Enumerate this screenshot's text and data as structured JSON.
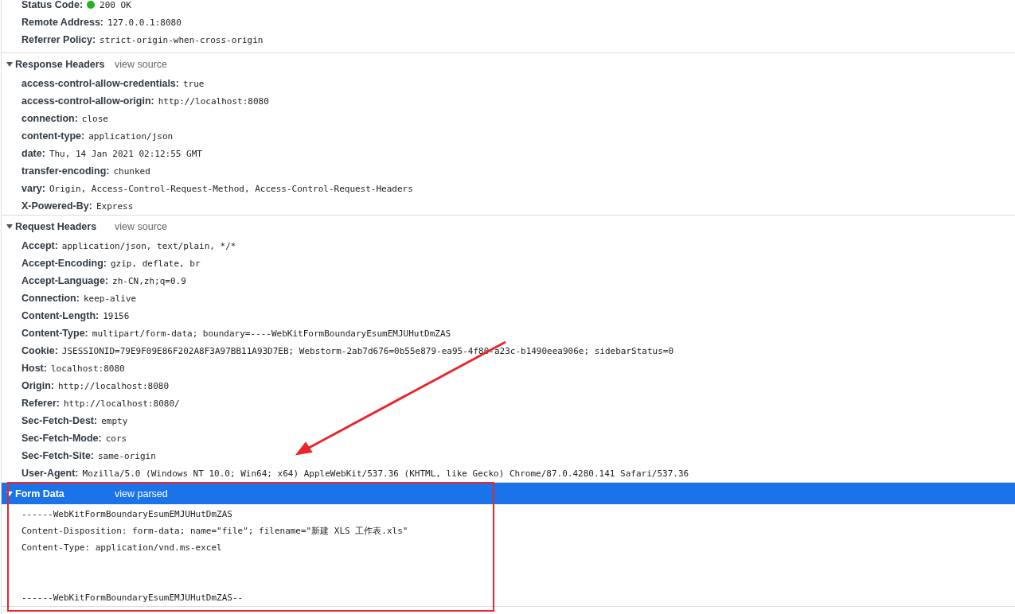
{
  "general": {
    "rows": [
      {
        "name": "Status Code:",
        "value": "200 OK",
        "kind": "status"
      },
      {
        "name": "Remote Address:",
        "value": "127.0.0.1:8080",
        "kind": "plain"
      },
      {
        "name": "Referrer Policy:",
        "value": "strict-origin-when-cross-origin",
        "kind": "plain"
      }
    ]
  },
  "sections": [
    {
      "title": "Response Headers",
      "link": "view source",
      "expanded": true,
      "selected": false,
      "rows": [
        {
          "name": "access-control-allow-credentials:",
          "value": "true"
        },
        {
          "name": "access-control-allow-origin:",
          "value": "http://localhost:8080"
        },
        {
          "name": "connection:",
          "value": "close"
        },
        {
          "name": "content-type:",
          "value": "application/json"
        },
        {
          "name": "date:",
          "value": "Thu, 14 Jan 2021 02:12:55 GMT"
        },
        {
          "name": "transfer-encoding:",
          "value": "chunked"
        },
        {
          "name": "vary:",
          "value": "Origin, Access-Control-Request-Method, Access-Control-Request-Headers"
        },
        {
          "name": "X-Powered-By:",
          "value": "Express"
        }
      ]
    },
    {
      "title": "Request Headers",
      "link": "view source",
      "expanded": true,
      "selected": false,
      "rows": [
        {
          "name": "Accept:",
          "value": "application/json, text/plain, */*"
        },
        {
          "name": "Accept-Encoding:",
          "value": "gzip, deflate, br"
        },
        {
          "name": "Accept-Language:",
          "value": "zh-CN,zh;q=0.9"
        },
        {
          "name": "Connection:",
          "value": "keep-alive"
        },
        {
          "name": "Content-Length:",
          "value": "19156"
        },
        {
          "name": "Content-Type:",
          "value": "multipart/form-data; boundary=----WebKitFormBoundaryEsumEMJUHutDmZAS"
        },
        {
          "name": "Cookie:",
          "value": "JSESSIONID=79E9F09E86F202A8F3A97BB11A93D7EB; Webstorm-2ab7d676=0b55e879-ea95-4f80-a23c-b1490eea906e; sidebarStatus=0"
        },
        {
          "name": "Host:",
          "value": "localhost:8080"
        },
        {
          "name": "Origin:",
          "value": "http://localhost:8080"
        },
        {
          "name": "Referer:",
          "value": "http://localhost:8080/"
        },
        {
          "name": "Sec-Fetch-Dest:",
          "value": "empty"
        },
        {
          "name": "Sec-Fetch-Mode:",
          "value": "cors"
        },
        {
          "name": "Sec-Fetch-Site:",
          "value": "same-origin"
        },
        {
          "name": "User-Agent:",
          "value": "Mozilla/5.0 (Windows NT 10.0; Win64; x64) AppleWebKit/537.36 (KHTML, like Gecko) Chrome/87.0.4280.141 Safari/537.36"
        }
      ]
    },
    {
      "title": "Form Data",
      "link": "view parsed",
      "expanded": true,
      "selected": true,
      "parts": [
        {
          "lines": [
            "------WebKitFormBoundaryEsumEMJUHutDmZAS",
            "Content-Disposition: form-data; name=\"file\"; filename=\"新建 XLS 工作表.xls\"",
            "Content-Type: application/vnd.ms-excel"
          ]
        },
        {
          "lines": [
            "------WebKitFormBoundaryEsumEMJUHutDmZAS--"
          ]
        }
      ]
    }
  ]
}
